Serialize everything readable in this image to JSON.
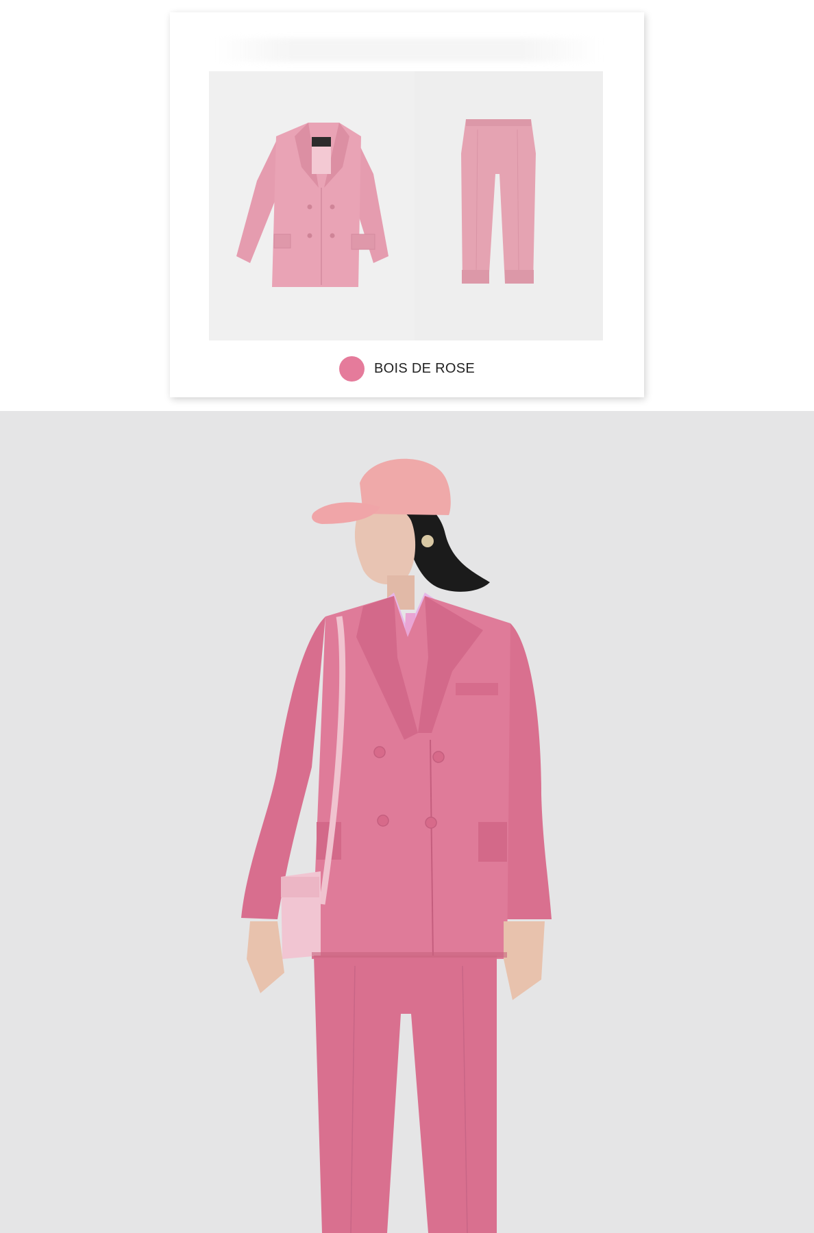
{
  "product_card": {
    "color_option": {
      "name": "BOIS DE ROSE",
      "swatch_color": "#e57b9b"
    },
    "images": {
      "flatlay_background": "#efefef",
      "jacket_color": "#e8a2b4",
      "trousers_color": "#e3a2b0"
    }
  },
  "model_photo": {
    "background": "#e5e5e6",
    "suit_color": "#d9708f",
    "cap_color": "#efa9a9",
    "shirt_color": "#e5b4e6",
    "bag_color": "#f1c5d2"
  },
  "icons": {
    "swatch": "color-swatch-circle"
  }
}
